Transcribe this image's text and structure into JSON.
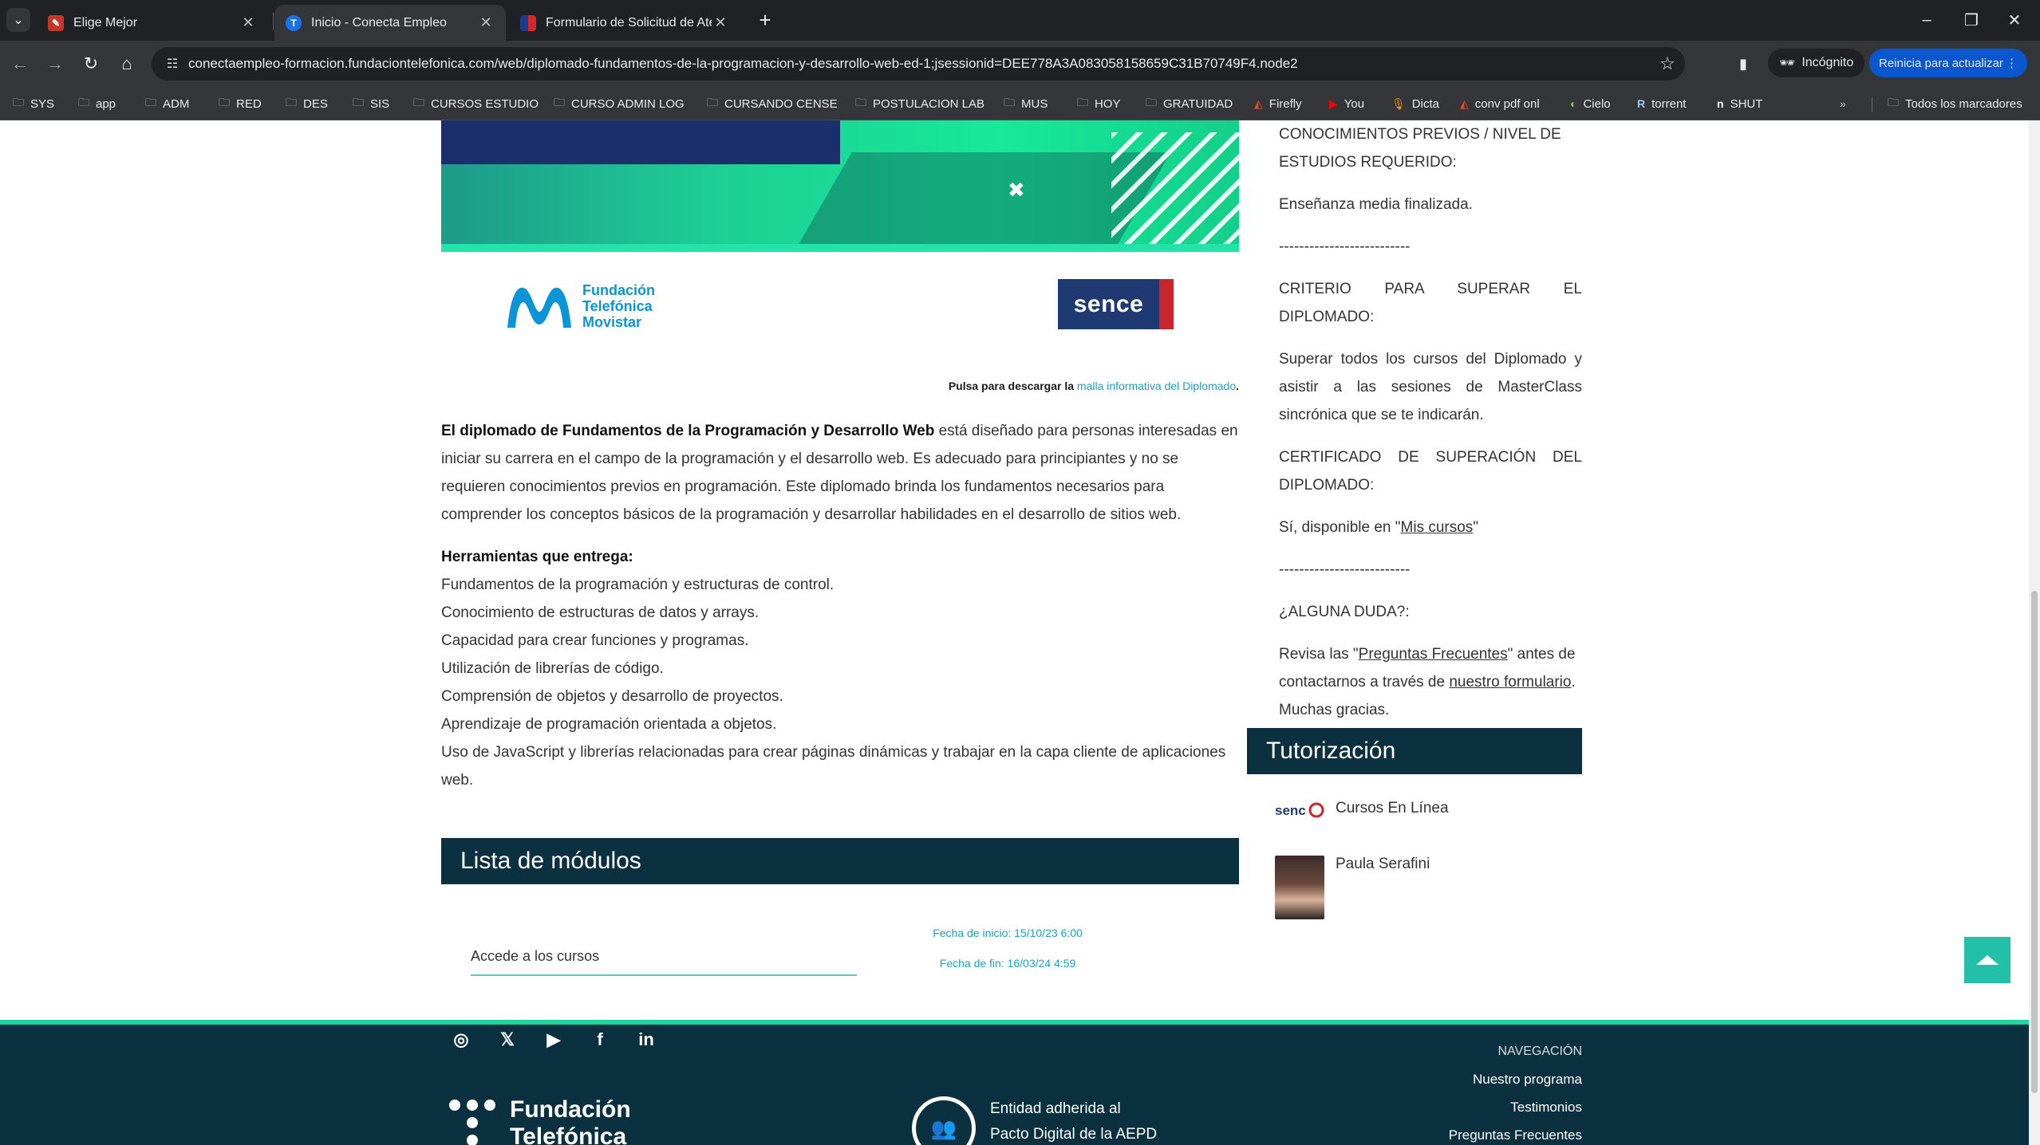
{
  "browser": {
    "tabs": [
      {
        "title": "Elige Mejor",
        "active": false
      },
      {
        "title": "Inicio - Conecta Empleo",
        "active": true
      },
      {
        "title": "Formulario de Solicitud de Aten",
        "active": false
      }
    ],
    "url": "conectaempleo-formacion.fundaciontelefonica.com/web/diplomado-fundamentos-de-la-programacion-y-desarrollo-web-ed-1;jsessionid=DEE778A3A083058158659C31B70749F4.node2",
    "incognito_label": "Incógnito",
    "restart_label": "Reinicia para actualizar",
    "bookmarks": [
      "SYS",
      "app",
      "ADM",
      "RED",
      "DES",
      "SIS",
      "CURSOS ESTUDIO",
      "CURSO ADMIN LOG",
      "CURSANDO CENSE",
      "POSTULACION LAB",
      "MUS",
      "HOY",
      "GRATUIDAD",
      "Firefly",
      "You",
      "Dicta",
      "conv pdf onl",
      "Cielo",
      "torrent",
      "SHUT"
    ],
    "all_bookmarks_label": "Todos los marcadores",
    "colors": {
      "tabstrip": "#202124",
      "toolbar": "#35363a",
      "accent": "#0b57d0"
    }
  },
  "main": {
    "logos": {
      "fundacion": "Fundación",
      "telefonica": "Telefónica",
      "movistar": "Movistar",
      "sence": "sence"
    },
    "download_prefix": "Pulsa para descargar la ",
    "download_link": "malla informativa del Diplomado",
    "download_suffix": ".",
    "intro_bold": "El diplomado de Fundamentos de la Programación y Desarrollo Web",
    "intro_rest": " está diseñado para personas interesadas en iniciar su carrera en el campo de la programación y el desarrollo web. Es adecuado para principiantes y no se requieren conocimientos previos en programación. Este diplomado brinda los fundamentos necesarios para comprender los conceptos básicos de la programación y desarrollar habilidades en el desarrollo de sitios web.",
    "tools_heading": "Herramientas que entrega:",
    "tools": [
      "Fundamentos de la programación y estructuras de control.",
      "Conocimiento de estructuras de datos y arrays.",
      "Capacidad para crear funciones y programas.",
      "Utilización de librerías de código.",
      "Comprensión de objetos y desarrollo de proyectos.",
      "Aprendizaje de programación orientada a objetos.",
      "Uso de JavaScript y librerías relacionadas para crear páginas dinámicas y trabajar en la capa cliente de aplicaciones web."
    ],
    "modules_title": "Lista de módulos",
    "module_link": "Accede a los cursos",
    "start_date": "Fecha de inicio: 15/10/23 6:00",
    "end_date": "Fecha de fin: 16/03/24 4:59"
  },
  "sidebar": {
    "prereq_heading": "CONOCIMIENTOS PREVIOS / NIVEL DE ESTUDIOS REQUERIDO:",
    "prereq_value": "Enseñanza media finalizada.",
    "divider": "--------------------------",
    "criteria_heading": "CRITERIO PARA SUPERAR EL DIPLOMADO:",
    "criteria_value": "Superar todos los cursos del Diplomado y asistir a las sesiones de MasterClass sincrónica que se te indicarán.",
    "cert_heading": "CERTIFICADO DE SUPERACIÓN DEL DIPLOMADO:",
    "cert_prefix": "Sí, disponible en \"",
    "cert_link": "Mis cursos",
    "cert_suffix": "\"",
    "doubt_heading": "¿ALGUNA DUDA?:",
    "doubt_prefix": "Revisa las \"",
    "faq_link": "Preguntas Frecuentes",
    "doubt_middle": "\" antes de contactarnos a través de ",
    "form_link": "nuestro formulario",
    "doubt_suffix": ". Muchas gracias.",
    "tutor_title": "Tutorización",
    "tutors": [
      "Cursos En Línea",
      "Paula Serafini"
    ]
  },
  "footer": {
    "social": [
      "instagram",
      "x",
      "youtube",
      "facebook",
      "linkedin"
    ],
    "logo_line1": "Fundación",
    "logo_line2": "Telefónica",
    "aepd_line1": "Entidad adherida al",
    "aepd_line2": "Pacto Digital de la AEPD",
    "nav_heading": "NAVEGACIÓN",
    "nav_links": [
      "Nuestro programa",
      "Testimonios",
      "Preguntas Frecuentes"
    ],
    "colors": {
      "bg": "#0b3140",
      "accent": "#1fd6a2"
    }
  }
}
